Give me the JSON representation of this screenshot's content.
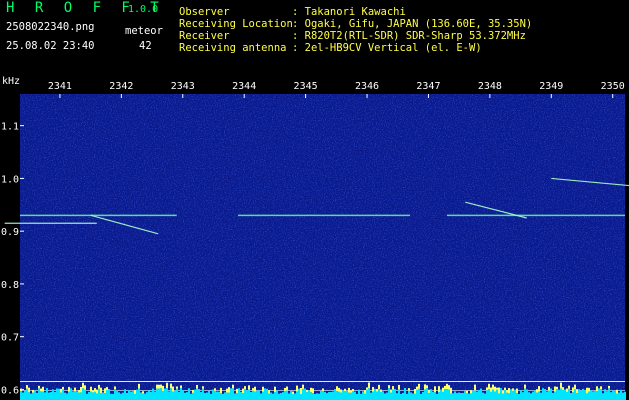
{
  "app": {
    "logo": "H R O F F T",
    "version": "1.0.0",
    "filename": "2508022340.png",
    "datetime": "25.08.02 23:40",
    "meteor_label": "meteor",
    "meteor_count": "42"
  },
  "info": {
    "rows": [
      {
        "label": "Observer",
        "value": ": Takanori Kawachi"
      },
      {
        "label": "Receiving Location",
        "value": ": Ogaki, Gifu, JAPAN (136.60E, 35.35N)"
      },
      {
        "label": "Receiver",
        "value": ": R820T2(RTL-SDR) SDR-Sharp 53.372MHz"
      },
      {
        "label": "Receiving antenna",
        "value": ": 2el-HB9CV Vertical (el. E-W)"
      }
    ]
  },
  "chart_data": {
    "type": "heatmap",
    "ylabel": "kHz",
    "xticks": [
      "2341",
      "2342",
      "2343",
      "2344",
      "2345",
      "2346",
      "2347",
      "2348",
      "2349",
      "2350"
    ],
    "yticks": [
      "1.1",
      "1.0",
      "0.9",
      "0.8",
      "0.7",
      "0.6"
    ],
    "ylim": [
      0.58,
      1.16
    ],
    "background_color": "#0a1a8c",
    "signal_color": "#ffff66",
    "level_color": "#00e5ff",
    "carrier_khz": 0.93,
    "echo_traces": [
      {
        "x_start": 2340.1,
        "x_end": 2341.6,
        "y": 0.915
      },
      {
        "x_start": 2341.5,
        "x_end": 2342.6,
        "y_start": 0.93,
        "y_end": 0.895
      },
      {
        "x_start": 2347.6,
        "x_end": 2348.6,
        "y_start": 0.955,
        "y_end": 0.925
      },
      {
        "x_start": 2349.0,
        "x_end": 2350.4,
        "y_start": 1.0,
        "y_end": 0.985
      }
    ]
  }
}
